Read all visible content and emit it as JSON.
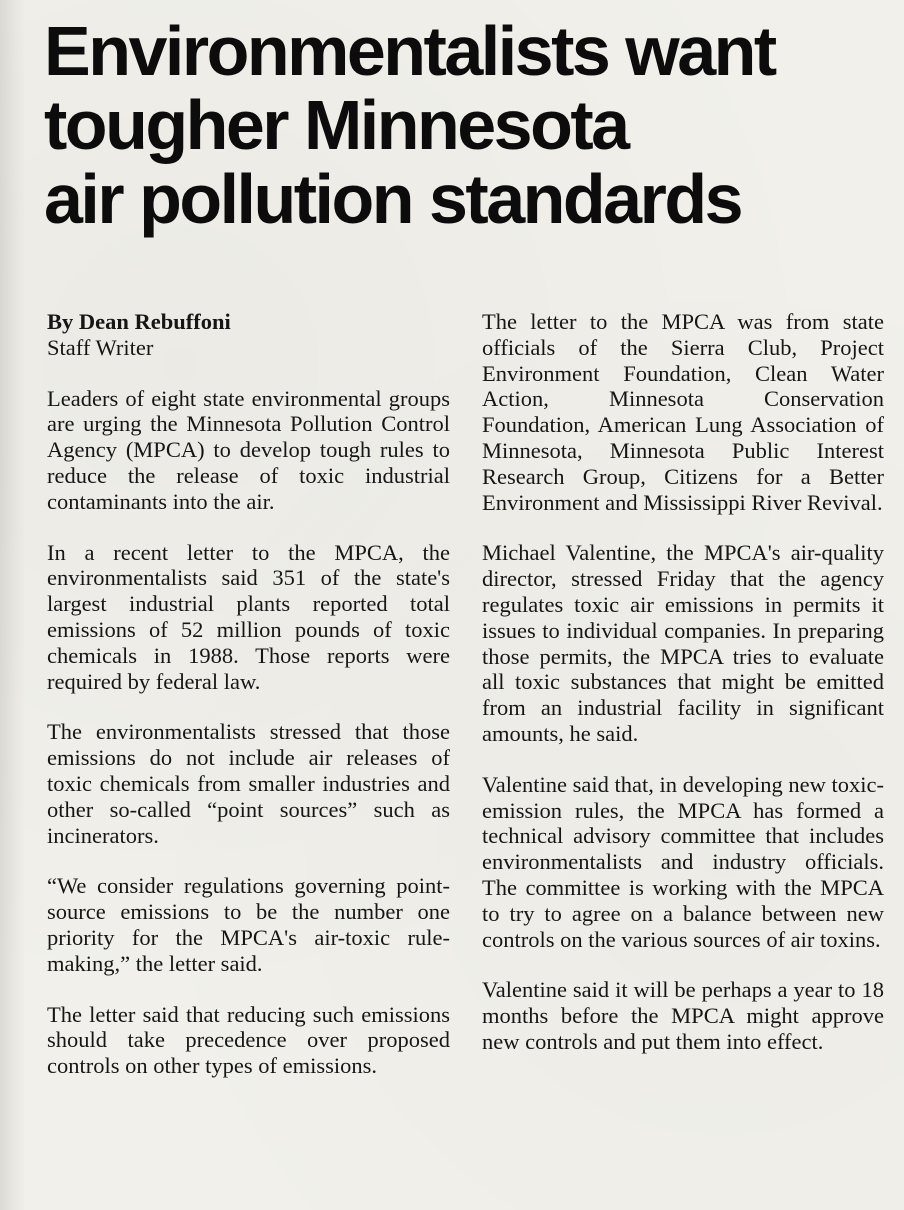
{
  "headline": {
    "lines": [
      "Environmentalists want",
      "tougher Minnesota",
      "air pollution standards"
    ]
  },
  "byline": {
    "author": "By Dean Rebuffoni",
    "role": "Staff Writer"
  },
  "left_column": {
    "paragraphs": [
      "Leaders of eight state environmental groups are urging the Minnesota Pollution Control Agency (MPCA) to develop tough rules to reduce the release of toxic industrial contaminants into the air.",
      "In a recent letter to the MPCA, the environmentalists said 351 of the state's largest industrial plants reported total emissions of 52 million pounds of toxic chemicals in 1988. Those reports were required by federal law.",
      "The environmentalists stressed that those emissions do not include air releases of toxic chemicals from smaller industries and other so-called “point sources” such as incinerators.",
      "“We consider regulations governing point-source emissions to be the number one priority for the MPCA's air-toxic rule-making,” the letter said.",
      "The letter said that reducing such emissions should take precedence over proposed controls on other types of emissions."
    ]
  },
  "right_column": {
    "paragraphs": [
      "The letter to the MPCA was from state officials of the Sierra Club, Project Environment Foundation, Clean Water Action, Minnesota Conservation Foundation, American Lung Association of Minnesota, Minnesota Public Interest Research Group, Citizens for a Better Environment and Mississippi River Revival.",
      "Michael Valentine, the MPCA's air-quality director, stressed Friday that the agency regulates toxic air emissions in permits it issues to individual companies. In preparing those permits, the MPCA tries to evaluate all toxic substances that might be emitted from an industrial facility in significant amounts, he said.",
      "Valentine said that, in developing new toxic-emission rules, the MPCA has formed a technical advisory committee that includes environmentalists and industry officials. The committee is working with the MPCA to try to agree on a balance between new controls on the various sources of air toxins.",
      "Valentine said it will be perhaps a year to 18 months before the MPCA might approve new controls and put them into effect."
    ]
  }
}
